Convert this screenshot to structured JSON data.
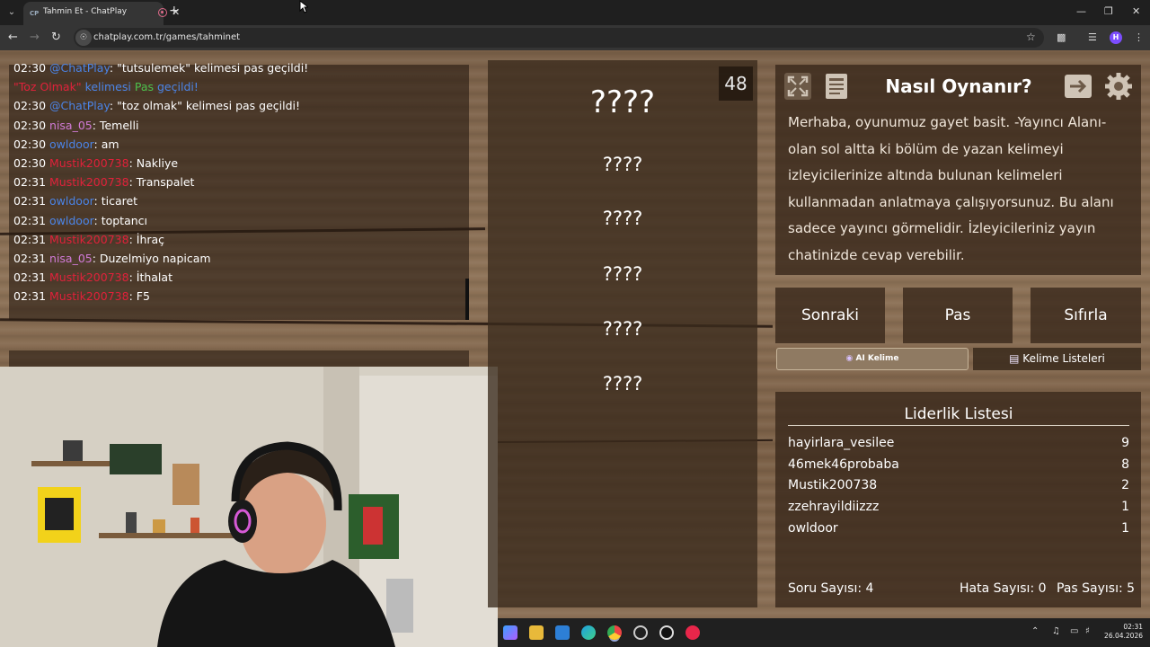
{
  "browser": {
    "tab_title": "Tahmin Et - ChatPlay",
    "tab_favicon": "CP",
    "url": "chatplay.com.tr/games/tahminet",
    "profile_initial": "H"
  },
  "chat": {
    "messages": [
      {
        "time": "02:30",
        "user": "@ChatPlay",
        "text": ": \"tutsulemek\" kelimesi pas geçildi!",
        "user_color": "blue"
      },
      {
        "time": "",
        "user": "\"Toz Olmak\"",
        "text": "",
        "extra_blue": "kelimesi",
        "extra_green": "Pas",
        "extra_blue2": "geçildi!",
        "user_color": "red"
      },
      {
        "time": "02:30",
        "user": "@ChatPlay",
        "text": ": \"toz olmak\" kelimesi pas geçildi!",
        "user_color": "blue"
      },
      {
        "time": "02:30",
        "user": "nisa_05",
        "text": ": Temelli",
        "user_color": "pink"
      },
      {
        "time": "02:30",
        "user": "owldoor",
        "text": ": am",
        "user_color": "blue"
      },
      {
        "time": "02:30",
        "user": "Mustik200738",
        "text": ": Nakliye",
        "user_color": "red"
      },
      {
        "time": "02:31",
        "user": "Mustik200738",
        "text": ": Transpalet",
        "user_color": "red"
      },
      {
        "time": "02:31",
        "user": "owldoor",
        "text": ": ticaret",
        "user_color": "blue"
      },
      {
        "time": "02:31",
        "user": "owldoor",
        "text": ": toptancı",
        "user_color": "blue"
      },
      {
        "time": "02:31",
        "user": "Mustik200738",
        "text": ": İhraç",
        "user_color": "red"
      },
      {
        "time": "02:31",
        "user": "nisa_05",
        "text": ": Duzelmiyo napicam",
        "user_color": "pink"
      },
      {
        "time": "02:31",
        "user": "Mustik200738",
        "text": ": İthalat",
        "user_color": "red"
      },
      {
        "time": "02:31",
        "user": "Mustik200738",
        "text": ": F5",
        "user_color": "red"
      }
    ]
  },
  "game": {
    "timer": "48",
    "main_word": "????",
    "taboo_words": [
      "????",
      "????",
      "????",
      "????",
      "????"
    ]
  },
  "howto": {
    "title": "Nasıl Oynanır?",
    "text": "Merhaba, oyunumuz gayet basit. -Yayıncı Alanı- olan sol altta ki bölüm de yazan kelimeyi izleyicilerinize altında bulunan kelimeleri kullanmadan anlatmaya çalışıyorsunuz. Bu alanı sadece yayıncı görmelidir. İzleyicileriniz yayın chatinizde cevap verebilir."
  },
  "actions": {
    "next": "Sonraki",
    "pass": "Pas",
    "reset": "Sıfırla",
    "ai_word": "AI Kelime",
    "word_lists": "Kelime Listeleri"
  },
  "leaderboard": {
    "title": "Liderlik Listesi",
    "entries": [
      {
        "name": "hayirlara_vesilee",
        "score": "9"
      },
      {
        "name": "46mek46probaba",
        "score": "8"
      },
      {
        "name": "Mustik200738",
        "score": "2"
      },
      {
        "name": "zzehrayildiizzz",
        "score": "1"
      },
      {
        "name": "owldoor",
        "score": "1"
      }
    ],
    "question_count": "Soru Sayısı: 4",
    "error_count": "Hata Sayısı: 0",
    "pass_count": "Pas Sayısı: 5"
  },
  "taskbar": {
    "time": "02:31",
    "date": "26.04.2026"
  },
  "colors": {
    "user_blue": "#4b84e6",
    "user_red": "#e0213a",
    "user_pink": "#d07ad6",
    "pas_green": "#4cc04c",
    "panel": "#3a2a1c"
  }
}
